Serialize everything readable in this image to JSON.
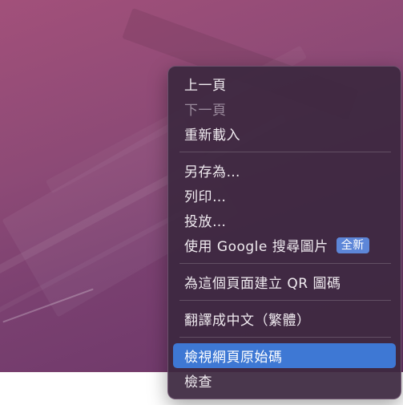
{
  "menu": {
    "group1": [
      {
        "label": "上一頁",
        "enabled": true
      },
      {
        "label": "下一頁",
        "enabled": false
      },
      {
        "label": "重新載入",
        "enabled": true
      }
    ],
    "group2": [
      {
        "label": "另存為…",
        "enabled": true
      },
      {
        "label": "列印…",
        "enabled": true
      },
      {
        "label": "投放…",
        "enabled": true
      },
      {
        "label": "使用 Google 搜尋圖片",
        "enabled": true,
        "badge": "全新"
      }
    ],
    "group3": [
      {
        "label": "為這個頁面建立 QR 圖碼",
        "enabled": true
      }
    ],
    "group4": [
      {
        "label": "翻譯成中文（繁體）",
        "enabled": true
      }
    ],
    "group5": [
      {
        "label": "檢視網頁原始碼",
        "enabled": true,
        "selected": true
      },
      {
        "label": "檢查",
        "enabled": true
      }
    ]
  },
  "colors": {
    "selection": "#3e78d4",
    "badge": "#5d86d8",
    "menu_bg": "#3c2840"
  }
}
